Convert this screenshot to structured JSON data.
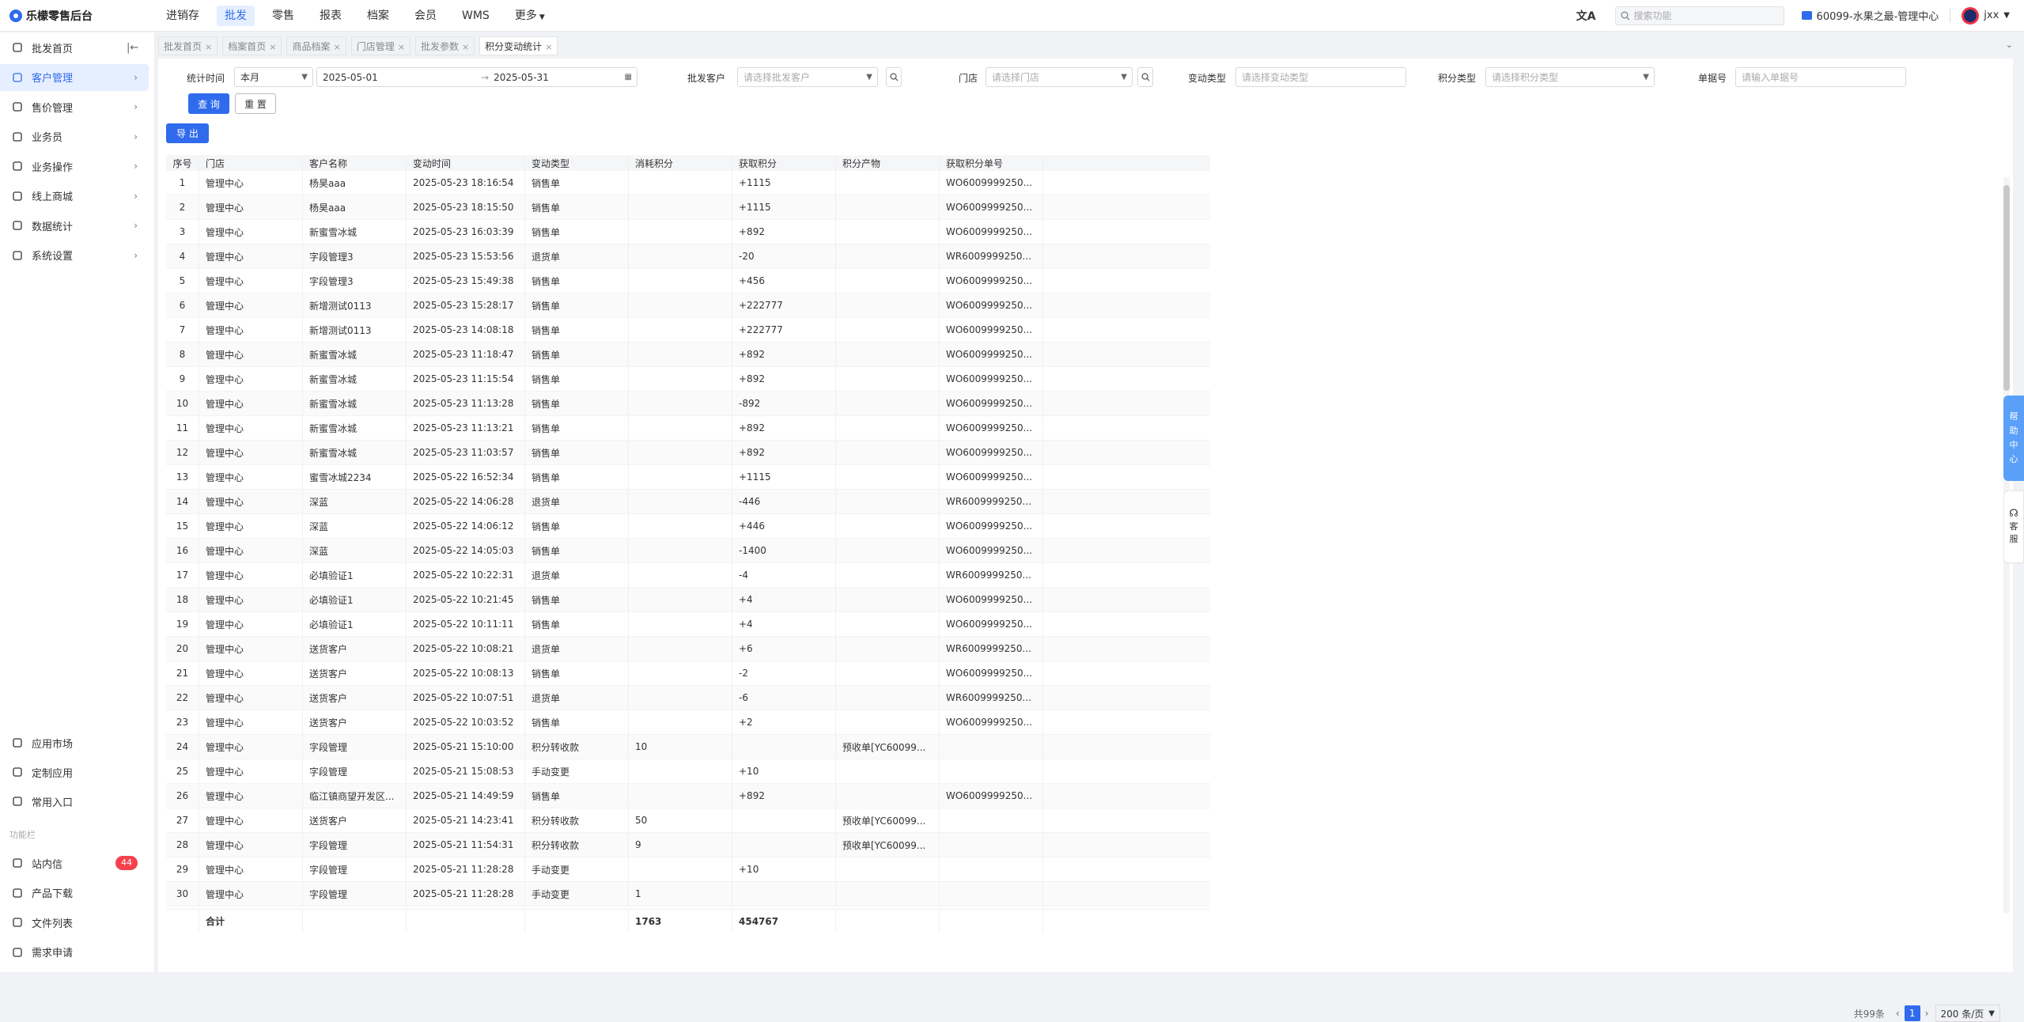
{
  "app": {
    "title": "乐檬零售后台"
  },
  "topnav": [
    {
      "label": "进销存",
      "active": false
    },
    {
      "label": "批发",
      "active": true
    },
    {
      "label": "零售",
      "active": false
    },
    {
      "label": "报表",
      "active": false
    },
    {
      "label": "档案",
      "active": false
    },
    {
      "label": "会员",
      "active": false
    },
    {
      "label": "WMS",
      "active": false
    },
    {
      "label": "更多",
      "active": false
    }
  ],
  "header": {
    "search_placeholder": "搜索功能",
    "store_label": "60099-水果之最-管理中心",
    "user": "jxx",
    "translate_icon": "translate-icon"
  },
  "sidebar": {
    "items": [
      {
        "label": "批发首页",
        "icon": "home-icon"
      },
      {
        "label": "客户管理",
        "icon": "user-icon",
        "active": true
      },
      {
        "label": "售价管理",
        "icon": "price-icon"
      },
      {
        "label": "业务员",
        "icon": "person-icon"
      },
      {
        "label": "业务操作",
        "icon": "operation-icon"
      },
      {
        "label": "线上商城",
        "icon": "shop-icon"
      },
      {
        "label": "数据统计",
        "icon": "chart-icon"
      },
      {
        "label": "系统设置",
        "icon": "settings-icon"
      }
    ],
    "bottom_items": [
      {
        "label": "应用市场",
        "icon": "appstore-icon"
      },
      {
        "label": "定制应用",
        "icon": "custom-app-icon"
      },
      {
        "label": "常用入口",
        "icon": "heart-icon"
      }
    ],
    "section_label": "功能栏",
    "func_items": [
      {
        "label": "站内信",
        "icon": "message-icon",
        "badge": "44"
      },
      {
        "label": "产品下载",
        "icon": "download-icon"
      },
      {
        "label": "文件列表",
        "icon": "file-list-icon"
      },
      {
        "label": "需求申请",
        "icon": "request-icon"
      }
    ]
  },
  "tabs": [
    {
      "label": "批发首页",
      "active": false
    },
    {
      "label": "档案首页",
      "active": false
    },
    {
      "label": "商品档案",
      "active": false
    },
    {
      "label": "门店管理",
      "active": false
    },
    {
      "label": "批发参数",
      "active": false
    },
    {
      "label": "积分变动统计",
      "active": true
    }
  ],
  "filters": {
    "time_label": "统计时间",
    "period_value": "本月",
    "date_start": "2025-05-01",
    "date_arrow": "→",
    "date_end": "2025-05-31",
    "customer_label": "批发客户",
    "customer_placeholder": "请选择批发客户",
    "store_label": "门店",
    "store_placeholder": "请选择门店",
    "change_type_label": "变动类型",
    "change_type_placeholder": "请选择变动类型",
    "points_type_label": "积分类型",
    "points_type_placeholder": "请选择积分类型",
    "order_no_label": "单据号",
    "order_no_placeholder": "请输入单据号",
    "query_button": "查 询",
    "reset_button": "重 置",
    "export_button": "导 出"
  },
  "table": {
    "columns": [
      "序号",
      "门店",
      "客户名称",
      "变动时间",
      "变动类型",
      "消耗积分",
      "获取积分",
      "积分产物",
      "获取积分单号"
    ],
    "rows": [
      [
        "1",
        "管理中心",
        "杨昊aaa",
        "2025-05-23 18:16:54",
        "销售单",
        "",
        "+1115",
        "",
        "WO6009999250..."
      ],
      [
        "2",
        "管理中心",
        "杨昊aaa",
        "2025-05-23 18:15:50",
        "销售单",
        "",
        "+1115",
        "",
        "WO6009999250..."
      ],
      [
        "3",
        "管理中心",
        "新蜜雪冰城",
        "2025-05-23 16:03:39",
        "销售单",
        "",
        "+892",
        "",
        "WO6009999250..."
      ],
      [
        "4",
        "管理中心",
        "字段管理3",
        "2025-05-23 15:53:56",
        "退货单",
        "",
        "-20",
        "",
        "WR6009999250..."
      ],
      [
        "5",
        "管理中心",
        "字段管理3",
        "2025-05-23 15:49:38",
        "销售单",
        "",
        "+456",
        "",
        "WO6009999250..."
      ],
      [
        "6",
        "管理中心",
        "新增测试0113",
        "2025-05-23 15:28:17",
        "销售单",
        "",
        "+222777",
        "",
        "WO6009999250..."
      ],
      [
        "7",
        "管理中心",
        "新增测试0113",
        "2025-05-23 14:08:18",
        "销售单",
        "",
        "+222777",
        "",
        "WO6009999250..."
      ],
      [
        "8",
        "管理中心",
        "新蜜雪冰城",
        "2025-05-23 11:18:47",
        "销售单",
        "",
        "+892",
        "",
        "WO6009999250..."
      ],
      [
        "9",
        "管理中心",
        "新蜜雪冰城",
        "2025-05-23 11:15:54",
        "销售单",
        "",
        "+892",
        "",
        "WO6009999250..."
      ],
      [
        "10",
        "管理中心",
        "新蜜雪冰城",
        "2025-05-23 11:13:28",
        "销售单",
        "",
        "-892",
        "",
        "WO6009999250..."
      ],
      [
        "11",
        "管理中心",
        "新蜜雪冰城",
        "2025-05-23 11:13:21",
        "销售单",
        "",
        "+892",
        "",
        "WO6009999250..."
      ],
      [
        "12",
        "管理中心",
        "新蜜雪冰城",
        "2025-05-23 11:03:57",
        "销售单",
        "",
        "+892",
        "",
        "WO6009999250..."
      ],
      [
        "13",
        "管理中心",
        "蜜雪冰城2234",
        "2025-05-22 16:52:34",
        "销售单",
        "",
        "+1115",
        "",
        "WO6009999250..."
      ],
      [
        "14",
        "管理中心",
        "深蓝",
        "2025-05-22 14:06:28",
        "退货单",
        "",
        "-446",
        "",
        "WR6009999250..."
      ],
      [
        "15",
        "管理中心",
        "深蓝",
        "2025-05-22 14:06:12",
        "销售单",
        "",
        "+446",
        "",
        "WO6009999250..."
      ],
      [
        "16",
        "管理中心",
        "深蓝",
        "2025-05-22 14:05:03",
        "销售单",
        "",
        "-1400",
        "",
        "WO6009999250..."
      ],
      [
        "17",
        "管理中心",
        "必填验证1",
        "2025-05-22 10:22:31",
        "退货单",
        "",
        "-4",
        "",
        "WR6009999250..."
      ],
      [
        "18",
        "管理中心",
        "必填验证1",
        "2025-05-22 10:21:45",
        "销售单",
        "",
        "+4",
        "",
        "WO6009999250..."
      ],
      [
        "19",
        "管理中心",
        "必填验证1",
        "2025-05-22 10:11:11",
        "销售单",
        "",
        "+4",
        "",
        "WO6009999250..."
      ],
      [
        "20",
        "管理中心",
        "送货客户",
        "2025-05-22 10:08:21",
        "退货单",
        "",
        "+6",
        "",
        "WR6009999250..."
      ],
      [
        "21",
        "管理中心",
        "送货客户",
        "2025-05-22 10:08:13",
        "销售单",
        "",
        "-2",
        "",
        "WO6009999250..."
      ],
      [
        "22",
        "管理中心",
        "送货客户",
        "2025-05-22 10:07:51",
        "退货单",
        "",
        "-6",
        "",
        "WR6009999250..."
      ],
      [
        "23",
        "管理中心",
        "送货客户",
        "2025-05-22 10:03:52",
        "销售单",
        "",
        "+2",
        "",
        "WO6009999250..."
      ],
      [
        "24",
        "管理中心",
        "字段管理",
        "2025-05-21 15:10:00",
        "积分转收款",
        "10",
        "",
        "预收单[YC60099...",
        ""
      ],
      [
        "25",
        "管理中心",
        "字段管理",
        "2025-05-21 15:08:53",
        "手动变更",
        "",
        "+10",
        "",
        ""
      ],
      [
        "26",
        "管理中心",
        "临江镇商望开发区...",
        "2025-05-21 14:49:59",
        "销售单",
        "",
        "+892",
        "",
        "WO6009999250..."
      ],
      [
        "27",
        "管理中心",
        "送货客户",
        "2025-05-21 14:23:41",
        "积分转收款",
        "50",
        "",
        "预收单[YC60099...",
        ""
      ],
      [
        "28",
        "管理中心",
        "字段管理",
        "2025-05-21 11:54:31",
        "积分转收款",
        "9",
        "",
        "预收单[YC60099...",
        ""
      ],
      [
        "29",
        "管理中心",
        "字段管理",
        "2025-05-21 11:28:28",
        "手动变更",
        "",
        "+10",
        "",
        ""
      ],
      [
        "30",
        "管理中心",
        "字段管理",
        "2025-05-21 11:28:28",
        "手动变更",
        "1",
        "",
        "",
        ""
      ]
    ],
    "summary": {
      "label": "合计",
      "consumed": "1763",
      "gained": "454767"
    }
  },
  "pagination": {
    "total": "共99条",
    "current": "1",
    "page_size": "200 条/页"
  },
  "widgets": {
    "help": [
      "帮",
      "助",
      "中",
      "心"
    ],
    "kefu": [
      "客",
      "服"
    ]
  }
}
